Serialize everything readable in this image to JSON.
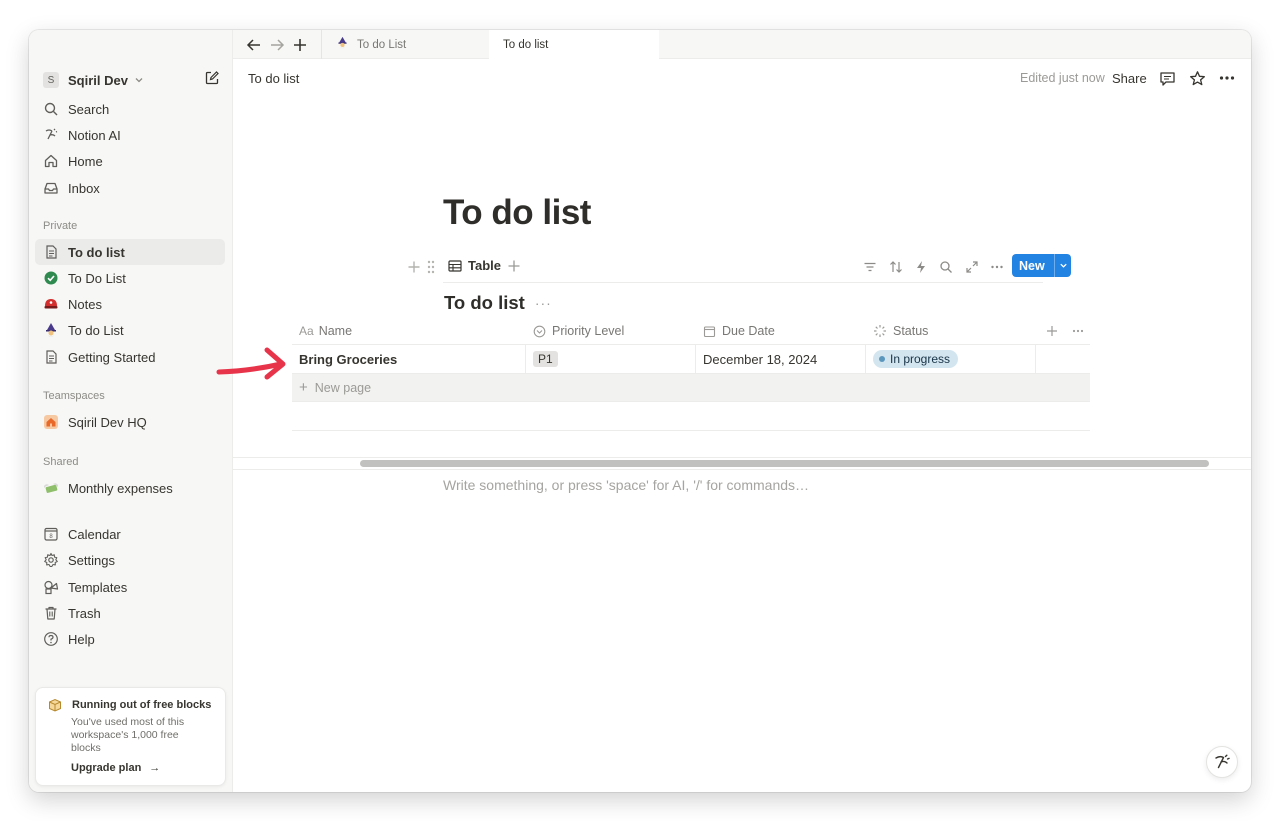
{
  "sidebar": {
    "workspace": {
      "badge": "S",
      "name": "Sqiril Dev"
    },
    "top_items": [
      {
        "label": "Search",
        "icon": "search-icon"
      },
      {
        "label": "Notion AI",
        "icon": "notion-ai-icon"
      },
      {
        "label": "Home",
        "icon": "home-icon"
      },
      {
        "label": "Inbox",
        "icon": "inbox-icon"
      }
    ],
    "private_heading": "Private",
    "private_items": [
      {
        "label": "To do list",
        "icon": "page-icon"
      },
      {
        "label": "To Do List",
        "icon": "check-circle-icon"
      },
      {
        "label": "Notes",
        "emoji": "🔴"
      },
      {
        "label": "To do List",
        "emoji": "🧙"
      },
      {
        "label": "Getting Started",
        "icon": "page-icon"
      }
    ],
    "teamspaces_heading": "Teamspaces",
    "teamspace": {
      "label": "Sqiril Dev HQ",
      "icon": "house-icon"
    },
    "shared_heading": "Shared",
    "shared_item": {
      "label": "Monthly expenses",
      "emoji": "💸"
    },
    "bottom_items": [
      {
        "label": "Calendar",
        "icon": "calendar-icon"
      },
      {
        "label": "Settings",
        "icon": "gear-icon"
      },
      {
        "label": "Templates",
        "icon": "templates-icon"
      },
      {
        "label": "Trash",
        "icon": "trash-icon"
      },
      {
        "label": "Help",
        "icon": "help-icon"
      }
    ],
    "upgrade": {
      "title": "Running out of free blocks",
      "desc": "You've used most of this workspace's 1,000 free blocks",
      "cta": "Upgrade plan"
    }
  },
  "tabs": [
    {
      "label": "To do List",
      "emoji": "🧙"
    },
    {
      "label": "To do list"
    }
  ],
  "topbar": {
    "breadcrumb": "To do list",
    "edited": "Edited just now",
    "share": "Share"
  },
  "page": {
    "title": "To do list",
    "view_label": "Table",
    "new_label": "New",
    "db_title": "To do list",
    "db_more": "···",
    "placeholder": "Write something, or press 'space' for AI, '/' for commands…"
  },
  "table": {
    "headers": [
      {
        "label": "Name",
        "prefix": "Aa"
      },
      {
        "label": "Priority Level"
      },
      {
        "label": "Due Date"
      },
      {
        "label": "Status"
      }
    ],
    "rows": [
      {
        "name": "Bring Groceries",
        "priority": "P1",
        "due": "December 18, 2024",
        "status": "In progress"
      }
    ],
    "new_page": "New page"
  },
  "colors": {
    "accent": "#2383e2",
    "arrow": "#e8344a",
    "status_bg": "#d3e5ef"
  }
}
